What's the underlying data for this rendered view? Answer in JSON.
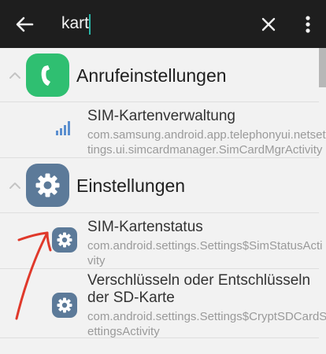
{
  "search": {
    "query": "kart"
  },
  "groups": [
    {
      "title": "Anrufeinstellungen",
      "icon": "phone-icon",
      "icon_color": "#2fbf71",
      "items": [
        {
          "title": "SIM-Kartenverwaltung",
          "subtitle_lines": [
            "com.samsung.android.app.telephonyui.netset",
            "tings.ui.simcardmanager.SimCardMgrActivity"
          ],
          "icon": "signal-bars-icon"
        }
      ]
    },
    {
      "title": "Einstellungen",
      "icon": "gear-icon",
      "icon_color": "#5c7a99",
      "items": [
        {
          "title": "SIM-Kartenstatus",
          "subtitle_lines": [
            "com.android.settings.Settings$SimStatusActi",
            "vity"
          ],
          "icon": "gear-icon"
        },
        {
          "title_lines": [
            "Verschlüsseln oder Entschlüsseln",
            "der SD-Karte"
          ],
          "subtitle_lines": [
            "com.android.settings.Settings$CryptSDCardS",
            "ettingsActivity"
          ],
          "icon": "gear-icon"
        }
      ]
    }
  ],
  "colors": {
    "toolbar_bg": "#1e1e1e",
    "annotation_arrow": "#e0392b",
    "accent_caret": "#29b6a8"
  }
}
